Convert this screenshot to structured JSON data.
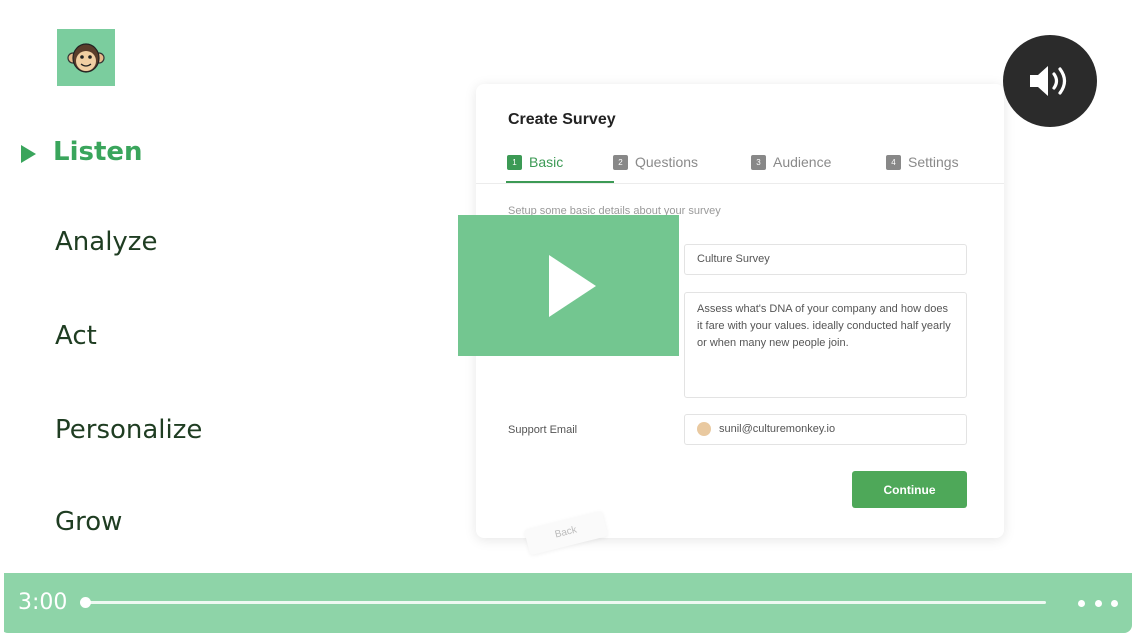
{
  "nav": {
    "items": [
      {
        "label": "Listen",
        "active": true
      },
      {
        "label": "Analyze",
        "active": false
      },
      {
        "label": "Act",
        "active": false
      },
      {
        "label": "Personalize",
        "active": false
      },
      {
        "label": "Grow",
        "active": false
      }
    ]
  },
  "survey": {
    "title": "Create Survey",
    "tabs": [
      {
        "num": "1",
        "label": "Basic"
      },
      {
        "num": "2",
        "label": "Questions"
      },
      {
        "num": "3",
        "label": "Audience"
      },
      {
        "num": "4",
        "label": "Settings"
      }
    ],
    "hint": "Setup some basic details about your survey",
    "survey_name_value": "Culture Survey",
    "description_value": "Assess what's DNA of your company and how does it fare with your values. ideally conducted half yearly or when many new people join.",
    "support_email_label": "Support Email",
    "support_email_value": "sunil@culturemonkey.io",
    "continue_label": "Continue",
    "back_label": "Back"
  },
  "player": {
    "time": "3:00",
    "progress_fraction": 0,
    "icons": {
      "play": "play-icon",
      "volume": "volume-icon",
      "more": "more-icon",
      "logo": "monkey-logo-icon"
    },
    "colors": {
      "brand_green": "#3aa55c",
      "overlay_green": "#6dc48b",
      "bar_green": "#8ed4a8",
      "volume_bg": "#2b2b2b"
    }
  }
}
